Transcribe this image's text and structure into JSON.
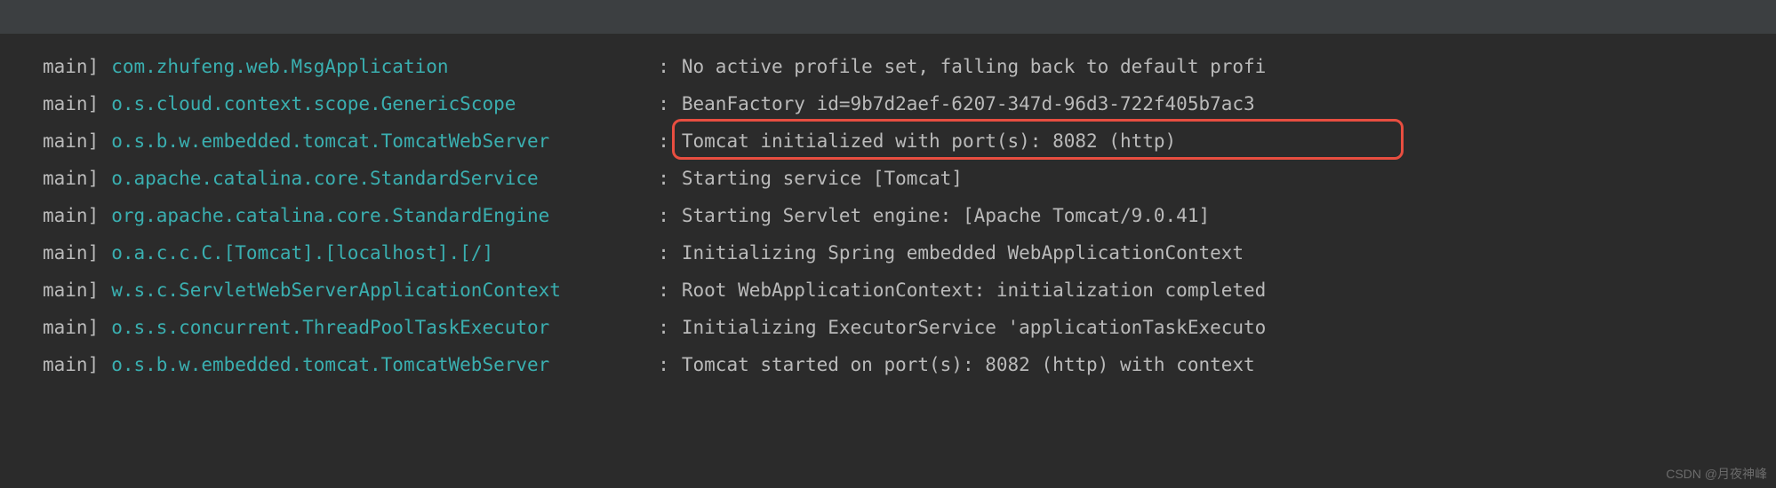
{
  "logs": [
    {
      "thread": "main]",
      "logger": "com.zhufeng.web.MsgApplication",
      "separator": ":",
      "message": "No active profile set, falling back to default profi"
    },
    {
      "thread": "main]",
      "logger": "o.s.cloud.context.scope.GenericScope",
      "separator": ":",
      "message": "BeanFactory id=9b7d2aef-6207-347d-96d3-722f405b7ac3"
    },
    {
      "thread": "main]",
      "logger": "o.s.b.w.embedded.tomcat.TomcatWebServer",
      "separator": ":",
      "message": "Tomcat initialized with port(s): 8082 (http)"
    },
    {
      "thread": "main]",
      "logger": "o.apache.catalina.core.StandardService",
      "separator": ":",
      "message": "Starting service [Tomcat]"
    },
    {
      "thread": "main]",
      "logger": "org.apache.catalina.core.StandardEngine",
      "separator": ":",
      "message": "Starting Servlet engine: [Apache Tomcat/9.0.41]"
    },
    {
      "thread": "main]",
      "logger": "o.a.c.c.C.[Tomcat].[localhost].[/]",
      "separator": ":",
      "message": "Initializing Spring embedded WebApplicationContext"
    },
    {
      "thread": "main]",
      "logger": "w.s.c.ServletWebServerApplicationContext",
      "separator": ":",
      "message": "Root WebApplicationContext: initialization completed"
    },
    {
      "thread": "main]",
      "logger": "o.s.s.concurrent.ThreadPoolTaskExecutor",
      "separator": ":",
      "message": "Initializing ExecutorService 'applicationTaskExecuto"
    },
    {
      "thread": "main]",
      "logger": "o.s.b.w.embedded.tomcat.TomcatWebServer",
      "separator": ":",
      "message": "Tomcat started on port(s): 8082 (http) with context"
    }
  ],
  "watermark": "CSDN @月夜神峰"
}
